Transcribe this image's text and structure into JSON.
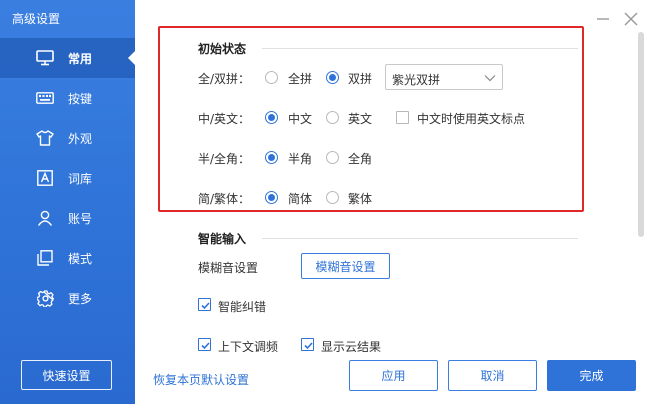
{
  "window": {
    "title": "高级设置"
  },
  "sidebar": {
    "items": [
      {
        "label": "常用",
        "icon": "monitor-icon",
        "active": true
      },
      {
        "label": "按键",
        "icon": "keyboard-icon",
        "active": false
      },
      {
        "label": "外观",
        "icon": "shirt-icon",
        "active": false
      },
      {
        "label": "词库",
        "icon": "dictionary-icon",
        "active": false
      },
      {
        "label": "账号",
        "icon": "user-icon",
        "active": false
      },
      {
        "label": "模式",
        "icon": "copy-icon",
        "active": false
      },
      {
        "label": "更多",
        "icon": "gear-icon",
        "active": false
      }
    ],
    "quick_settings": "快速设置"
  },
  "initial_state": {
    "title": "初始状态",
    "quanpin_row": {
      "label": "全/双拼：",
      "opt1": "全拼",
      "opt2": "双拼",
      "selected": "双拼",
      "scheme": "紫光双拼"
    },
    "cn_en_row": {
      "label": "中/英文：",
      "opt1": "中文",
      "opt2": "英文",
      "selected": "中文",
      "punct_check": "中文时使用英文标点",
      "punct_checked": false
    },
    "width_row": {
      "label": "半/全角：",
      "opt1": "半角",
      "opt2": "全角",
      "selected": "半角"
    },
    "trad_row": {
      "label": "简/繁体：",
      "opt1": "简体",
      "opt2": "繁体",
      "selected": "简体"
    }
  },
  "smart_input": {
    "title": "智能输入",
    "fuzzy_label": "模糊音设置",
    "fuzzy_button": "模糊音设置",
    "autocorrect": "智能纠错",
    "autocorrect_checked": true,
    "partial1": "上下文调频",
    "partial2": "显示云结果"
  },
  "footer": {
    "restore_link": "恢复本页默认设置",
    "apply": "应用",
    "cancel": "取消",
    "done": "完成"
  },
  "colors": {
    "accent": "#2f73d8",
    "sidebar": "#3a7fe0",
    "highlight_box": "#e02828"
  }
}
